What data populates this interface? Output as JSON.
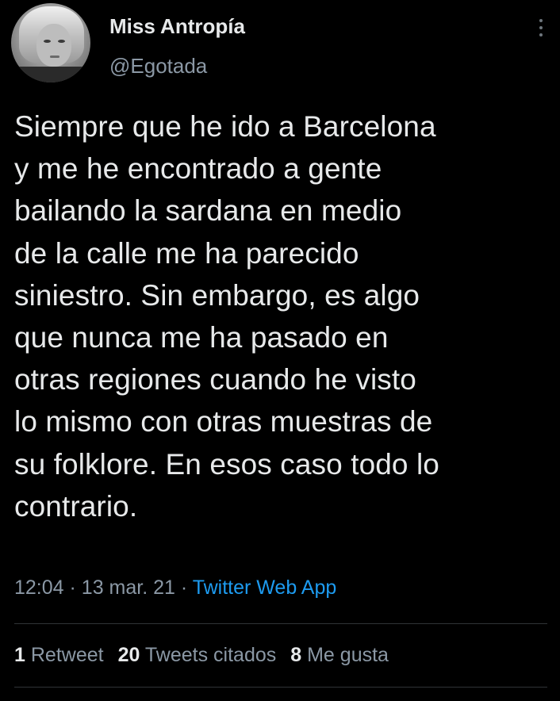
{
  "user": {
    "display_name": "Miss Antropía",
    "handle": "@Egotada"
  },
  "tweet": {
    "lines": [
      "Siempre que he ido a Barcelona",
      "y me he encontrado a gente",
      "bailando la sardana en medio",
      "de la calle me ha parecido",
      "siniestro. Sin embargo, es algo",
      "que nunca me ha pasado en",
      "otras regiones cuando he visto",
      "lo mismo con otras muestras de",
      "su folklore. En esos caso todo lo",
      "contrario."
    ],
    "time": "12:04",
    "date": "13 mar. 21",
    "separator": "·",
    "source": "Twitter Web App"
  },
  "stats": {
    "retweets_count": "1",
    "retweets_label": "Retweet",
    "quotes_count": "20",
    "quotes_label": "Tweets citados",
    "likes_count": "8",
    "likes_label": "Me gusta"
  },
  "icons": {
    "more": "more-vertical-icon"
  },
  "colors": {
    "background": "#000000",
    "text": "#e7e9ea",
    "secondary": "#8b98a5",
    "link": "#1d9bf0",
    "divider": "#2f3336"
  }
}
